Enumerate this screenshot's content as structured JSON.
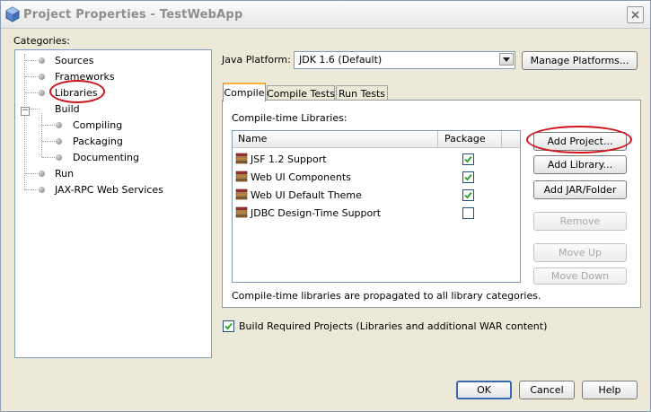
{
  "window": {
    "title": "Project Properties - TestWebApp"
  },
  "categories": {
    "label": "Categories:",
    "items": [
      {
        "label": "Sources"
      },
      {
        "label": "Frameworks"
      },
      {
        "label": "Libraries"
      },
      {
        "label": "Build"
      },
      {
        "label": "Compiling"
      },
      {
        "label": "Packaging"
      },
      {
        "label": "Documenting"
      },
      {
        "label": "Run"
      },
      {
        "label": "JAX-RPC Web Services"
      }
    ]
  },
  "platform": {
    "label": "Java Platform:",
    "value": "JDK 1.6 (Default)",
    "manage_label": "Manage Platforms..."
  },
  "tabs": [
    {
      "label": "Compile"
    },
    {
      "label": "Compile Tests"
    },
    {
      "label": "Run Tests"
    }
  ],
  "compile": {
    "libraries_label": "Compile-time Libraries:",
    "columns": [
      "Name",
      "Package"
    ],
    "rows": [
      {
        "name": "JSF 1.2 Support",
        "package": true
      },
      {
        "name": "Web UI Components",
        "package": true
      },
      {
        "name": "Web UI Default Theme",
        "package": true
      },
      {
        "name": "JDBC Design-Time Support",
        "package": false
      }
    ],
    "buttons": {
      "add_project": "Add Project...",
      "add_library": "Add Library...",
      "add_jar": "Add JAR/Folder",
      "remove": "Remove",
      "move_up": "Move Up",
      "move_down": "Move Down"
    },
    "note": "Compile-time libraries are propagated to all library categories."
  },
  "build_required": {
    "label": "Build Required Projects (Libraries and additional WAR content)",
    "checked": true
  },
  "footer": {
    "ok": "OK",
    "cancel": "Cancel",
    "help": "Help"
  },
  "colors": {
    "accent": "#3a6ab5",
    "highlight_ring": "#d0121a",
    "tab_active_top": "#f0b33a",
    "check": "#21a121"
  }
}
